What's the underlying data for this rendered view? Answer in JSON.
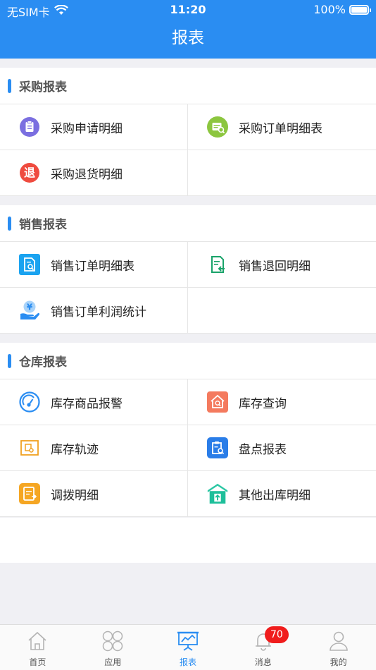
{
  "status": {
    "carrier": "无SIM卡",
    "time": "11:20",
    "battery": "100%",
    "battery_level": 1.0
  },
  "nav": {
    "title": "报表"
  },
  "sections": [
    {
      "title": "采购报表",
      "items": [
        {
          "label": "采购申请明细",
          "icon": "clipboard-icon",
          "color": "#7b6fe0"
        },
        {
          "label": "采购订单明细表",
          "icon": "order-search-icon",
          "color": "#8cc63f"
        },
        {
          "label": "采购退货明细",
          "icon": "return-icon",
          "color": "#ef4b3f",
          "glyph": "退"
        }
      ]
    },
    {
      "title": "销售报表",
      "items": [
        {
          "label": "销售订单明细表",
          "icon": "document-search-icon",
          "color": "#1aa3f0"
        },
        {
          "label": "销售退回明细",
          "icon": "document-return-icon",
          "color": "#1aa36a"
        },
        {
          "label": "销售订单利润统计",
          "icon": "profit-hand-icon",
          "color": "#2a8df2",
          "glyph": "¥"
        }
      ]
    },
    {
      "title": "仓库报表",
      "items": [
        {
          "label": "库存商品报警",
          "icon": "gauge-icon",
          "color": "#2a8df2"
        },
        {
          "label": "库存查询",
          "icon": "house-search-icon",
          "color": "#f47a5e"
        },
        {
          "label": "库存轨迹",
          "icon": "track-icon",
          "color": "#f0a020"
        },
        {
          "label": "盘点报表",
          "icon": "inventory-icon",
          "color": "#2a7de8"
        },
        {
          "label": "调拨明细",
          "icon": "transfer-icon",
          "color": "#f5a623"
        },
        {
          "label": "其他出库明细",
          "icon": "outbound-icon",
          "color": "#1dbf9a"
        }
      ]
    }
  ],
  "tabs": [
    {
      "label": "首页",
      "icon": "home-icon"
    },
    {
      "label": "应用",
      "icon": "apps-icon"
    },
    {
      "label": "报表",
      "icon": "chart-board-icon",
      "active": true
    },
    {
      "label": "消息",
      "icon": "bell-icon",
      "badge": "70"
    },
    {
      "label": "我的",
      "icon": "user-icon"
    }
  ]
}
